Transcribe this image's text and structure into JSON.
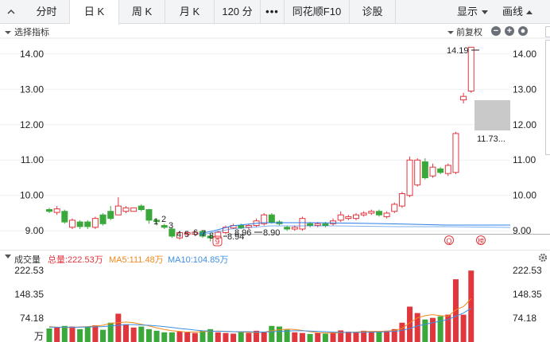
{
  "tabs": [
    {
      "label": "分时",
      "active": false
    },
    {
      "label": "日 K",
      "active": true
    },
    {
      "label": "周 K",
      "active": false
    },
    {
      "label": "月 K",
      "active": false
    },
    {
      "label": "120 分",
      "active": false
    },
    {
      "label": "•••",
      "active": false
    },
    {
      "label": "同花顺F10",
      "active": false
    },
    {
      "label": "诊股",
      "active": false
    }
  ],
  "toolbar": {
    "display_label": "显示",
    "draw_label": "画线"
  },
  "indicator": {
    "select_label": "选择指标",
    "adjust_label": "前复权"
  },
  "price_axis": {
    "ticks": [
      "14.00",
      "13.00",
      "12.00",
      "11.00",
      "10.00",
      "9.00"
    ]
  },
  "annotations": {
    "high_label": "14.19",
    "tooltip_value": "11.73...",
    "low_label": "8.94",
    "mid_label1": "8.96",
    "mid_label2": "8.90",
    "numbers": [
      "1",
      "2",
      "3",
      "4",
      "5",
      "6",
      "7",
      "8"
    ],
    "marker_q": "Q",
    "marker_bang": "榜",
    "marker_9": "9"
  },
  "volume": {
    "title": "成交量",
    "total_label": "总量:222.53万",
    "ma5_label": "MA5:111.48万",
    "ma10_label": "MA10:104.85万",
    "ticks": [
      "222.53",
      "148.35",
      "74.18",
      "万"
    ]
  },
  "colors": {
    "up": "#e0363d",
    "down": "#3aa83a",
    "ma5": "#f08a1c",
    "ma10": "#3f8fe0",
    "ind_lines": "#2b7de9"
  },
  "chart_data": {
    "type": "candlestick",
    "ylim": [
      8.6,
      14.4
    ],
    "candles": [
      {
        "o": 9.6,
        "c": 9.55,
        "h": 9.65,
        "l": 9.5
      },
      {
        "o": 9.52,
        "c": 9.62,
        "h": 9.7,
        "l": 9.45
      },
      {
        "o": 9.55,
        "c": 9.25,
        "h": 9.6,
        "l": 9.2
      },
      {
        "o": 9.1,
        "c": 9.3,
        "h": 9.35,
        "l": 9.05
      },
      {
        "o": 9.25,
        "c": 9.12,
        "h": 9.3,
        "l": 9.05
      },
      {
        "o": 9.25,
        "c": 9.12,
        "h": 9.3,
        "l": 9.05
      },
      {
        "o": 9.1,
        "c": 9.35,
        "h": 9.4,
        "l": 9.05
      },
      {
        "o": 9.45,
        "c": 9.2,
        "h": 9.5,
        "l": 9.15
      },
      {
        "o": 9.55,
        "c": 9.35,
        "h": 9.7,
        "l": 9.3
      },
      {
        "o": 9.45,
        "c": 9.7,
        "h": 9.95,
        "l": 9.45
      },
      {
        "o": 9.55,
        "c": 9.65,
        "h": 9.7,
        "l": 9.5
      },
      {
        "o": 9.55,
        "c": 9.65,
        "h": 9.65,
        "l": 9.55
      },
      {
        "o": 9.7,
        "c": 9.6,
        "h": 9.75,
        "l": 9.55
      },
      {
        "o": 9.6,
        "c": 9.3,
        "h": 9.62,
        "l": 9.2
      },
      {
        "o": 9.3,
        "c": 9.26,
        "h": 9.35,
        "l": 9.15
      },
      {
        "o": 9.15,
        "c": 9.1,
        "h": 9.2,
        "l": 9.05
      },
      {
        "o": 9.05,
        "c": 8.85,
        "h": 9.1,
        "l": 8.8
      },
      {
        "o": 8.8,
        "c": 8.95,
        "h": 8.98,
        "l": 8.75
      },
      {
        "o": 8.9,
        "c": 8.95,
        "h": 8.98,
        "l": 8.85
      },
      {
        "o": 8.9,
        "c": 8.96,
        "h": 9.0,
        "l": 8.85
      },
      {
        "o": 8.98,
        "c": 8.85,
        "h": 9.0,
        "l": 8.8
      },
      {
        "o": 8.85,
        "c": 8.8,
        "h": 8.9,
        "l": 8.7
      },
      {
        "o": 8.8,
        "c": 8.96,
        "h": 9.0,
        "l": 8.75
      },
      {
        "o": 8.95,
        "c": 9.1,
        "h": 9.15,
        "l": 8.9
      },
      {
        "o": 9.08,
        "c": 9.15,
        "h": 9.2,
        "l": 9.05
      },
      {
        "o": 9.15,
        "c": 9.08,
        "h": 9.2,
        "l": 9.05
      },
      {
        "o": 9.1,
        "c": 9.15,
        "h": 9.2,
        "l": 9.05
      },
      {
        "o": 9.15,
        "c": 9.28,
        "h": 9.35,
        "l": 9.1
      },
      {
        "o": 9.2,
        "c": 9.45,
        "h": 9.5,
        "l": 9.15
      },
      {
        "o": 9.45,
        "c": 9.25,
        "h": 9.5,
        "l": 9.2
      },
      {
        "o": 9.25,
        "c": 9.2,
        "h": 9.3,
        "l": 9.15
      },
      {
        "o": 9.1,
        "c": 9.05,
        "h": 9.15,
        "l": 9.0
      },
      {
        "o": 9.05,
        "c": 9.1,
        "h": 9.15,
        "l": 9.0
      },
      {
        "o": 9.05,
        "c": 9.35,
        "h": 9.4,
        "l": 9.0
      },
      {
        "o": 9.2,
        "c": 9.15,
        "h": 9.25,
        "l": 9.1
      },
      {
        "o": 9.15,
        "c": 9.2,
        "h": 9.25,
        "l": 9.1
      },
      {
        "o": 9.2,
        "c": 9.15,
        "h": 9.25,
        "l": 9.1
      },
      {
        "o": 9.2,
        "c": 9.28,
        "h": 9.35,
        "l": 9.15
      },
      {
        "o": 9.3,
        "c": 9.45,
        "h": 9.55,
        "l": 9.25
      },
      {
        "o": 9.35,
        "c": 9.4,
        "h": 9.45,
        "l": 9.3
      },
      {
        "o": 9.35,
        "c": 9.45,
        "h": 9.5,
        "l": 9.3
      },
      {
        "o": 9.45,
        "c": 9.5,
        "h": 9.55,
        "l": 9.4
      },
      {
        "o": 9.5,
        "c": 9.55,
        "h": 9.6,
        "l": 9.45
      },
      {
        "o": 9.55,
        "c": 9.45,
        "h": 9.6,
        "l": 9.4
      },
      {
        "o": 9.4,
        "c": 9.5,
        "h": 9.55,
        "l": 9.35
      },
      {
        "o": 9.55,
        "c": 9.75,
        "h": 9.8,
        "l": 9.5
      },
      {
        "o": 9.7,
        "c": 10.05,
        "h": 10.1,
        "l": 9.65
      },
      {
        "o": 10.0,
        "c": 11.0,
        "h": 11.1,
        "l": 9.95
      },
      {
        "o": 10.3,
        "c": 11.0,
        "h": 11.05,
        "l": 10.25
      },
      {
        "o": 10.95,
        "c": 10.5,
        "h": 11.05,
        "l": 10.45
      },
      {
        "o": 10.55,
        "c": 10.8,
        "h": 10.9,
        "l": 10.5
      },
      {
        "o": 10.75,
        "c": 10.65,
        "h": 10.8,
        "l": 10.6
      },
      {
        "o": 10.62,
        "c": 10.85,
        "h": 10.9,
        "l": 10.55
      },
      {
        "o": 10.65,
        "c": 11.75,
        "h": 11.8,
        "l": 10.6
      },
      {
        "o": 12.7,
        "c": 12.8,
        "h": 12.9,
        "l": 12.6
      },
      {
        "o": 12.95,
        "c": 14.19,
        "h": 14.19,
        "l": 12.9
      }
    ],
    "volumes": [
      42,
      45,
      50,
      48,
      40,
      46,
      52,
      38,
      60,
      88,
      55,
      45,
      48,
      40,
      35,
      30,
      30,
      32,
      30,
      28,
      35,
      40,
      30,
      28,
      26,
      30,
      28,
      35,
      30,
      50,
      48,
      38,
      30,
      28,
      25,
      28,
      26,
      30,
      36,
      32,
      30,
      35,
      30,
      32,
      35,
      40,
      60,
      110,
      90,
      70,
      75,
      80,
      85,
      195,
      85,
      222
    ],
    "ma5": [
      48,
      46,
      45,
      45,
      47,
      48,
      50,
      52,
      58,
      60,
      62,
      60,
      55,
      50,
      44,
      39,
      35,
      33,
      31,
      31,
      32,
      33,
      34,
      33,
      32,
      31,
      30,
      30,
      31,
      35,
      38,
      40,
      39,
      36,
      32,
      29,
      28,
      28,
      29,
      30,
      31,
      32,
      33,
      33,
      34,
      36,
      42,
      60,
      75,
      82,
      85,
      82,
      80,
      100,
      110,
      135
    ],
    "ma10": [
      46,
      46,
      46,
      46,
      46,
      47,
      47,
      48,
      50,
      52,
      54,
      54,
      53,
      52,
      50,
      48,
      45,
      42,
      40,
      37,
      35,
      34,
      33,
      33,
      32,
      32,
      32,
      31,
      31,
      32,
      33,
      34,
      35,
      35,
      34,
      33,
      32,
      31,
      30,
      30,
      30,
      30,
      31,
      31,
      32,
      33,
      36,
      42,
      50,
      55,
      60,
      65,
      70,
      80,
      90,
      105
    ],
    "vol_ylim": [
      0,
      222.53
    ]
  }
}
